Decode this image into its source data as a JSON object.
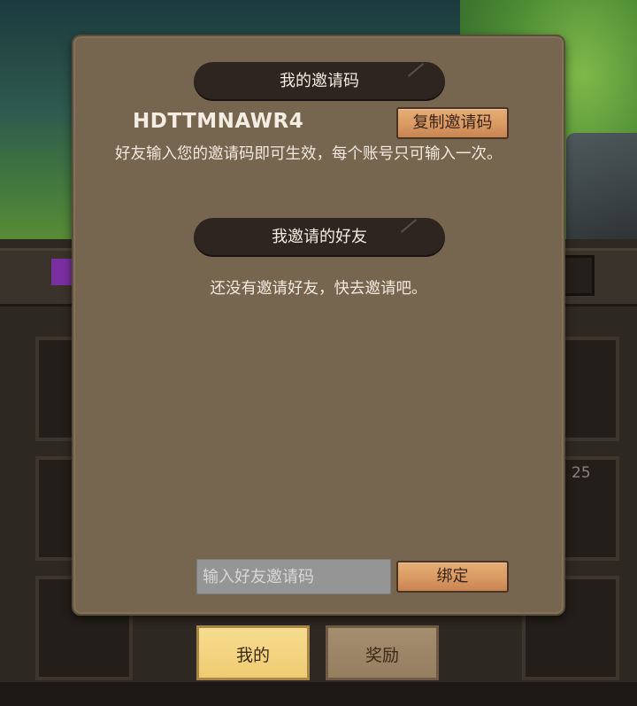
{
  "dialog": {
    "my_code_header": "我的邀请码",
    "invite_code": "HDTTMNAWR4",
    "copy_button": "复制邀请码",
    "description": "好友输入您的邀请码即可生效，每个账号只可输入一次。",
    "my_friends_header": "我邀请的好友",
    "empty_message": "还没有邀请好友，快去邀请吧。",
    "input_placeholder": "输入好友邀请码",
    "input_value": "",
    "bind_button": "绑定"
  },
  "tabs": [
    {
      "label": "我的",
      "selected": true
    },
    {
      "label": "奖励",
      "selected": false
    }
  ],
  "background": {
    "level_badge": "25"
  },
  "colors": {
    "panel": "#76654f",
    "header_pill": "#2e2520",
    "wood_button": "#d99a63",
    "tab_selected": "#efcc72",
    "tab_unselected": "#957d60"
  }
}
